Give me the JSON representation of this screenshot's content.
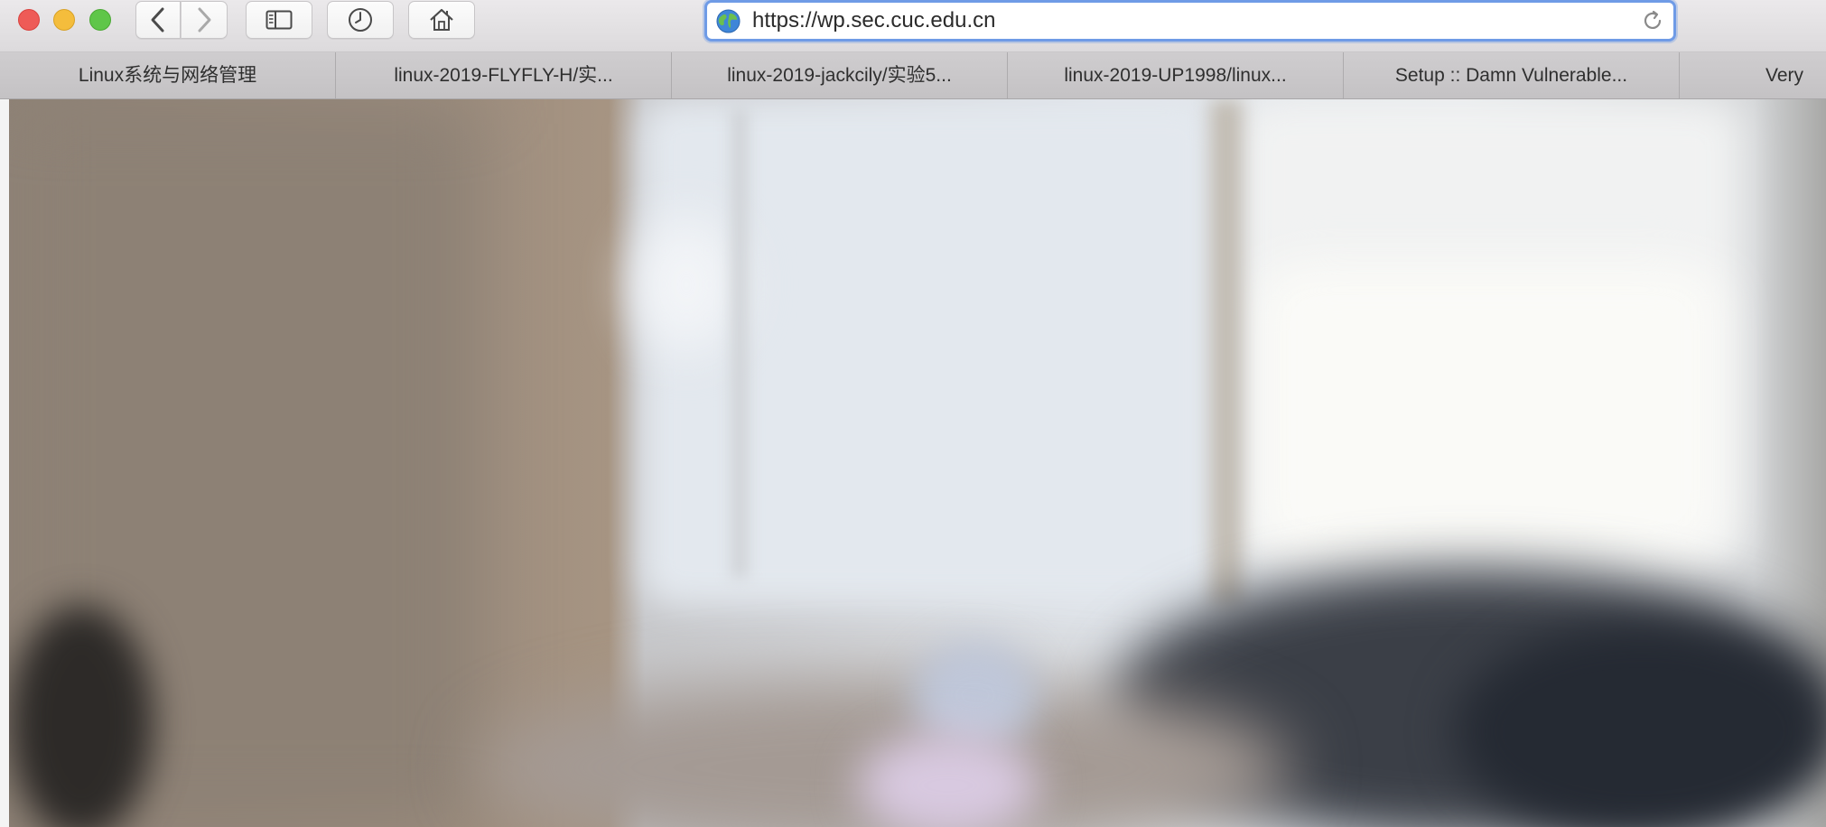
{
  "window": {
    "controls": {
      "close": "close-icon",
      "minimize": "minimize-icon",
      "zoom": "zoom-icon"
    }
  },
  "toolbar": {
    "back_icon": "chevron-left-icon",
    "forward_icon": "chevron-right-icon",
    "sidebar_icon": "sidebar-icon",
    "history_icon": "clock-icon",
    "home_icon": "home-icon"
  },
  "address_bar": {
    "url": "https://wp.sec.cuc.edu.cn",
    "site_icon": "globe-icon",
    "reload_icon": "reload-icon",
    "focus_color": "#6f9be6"
  },
  "bookmarks": [
    {
      "label": "Linux系统与网络管理"
    },
    {
      "label": "linux-2019-FLYFLY-H/实..."
    },
    {
      "label": "linux-2019-jackcily/实验5..."
    },
    {
      "label": "linux-2019-UP1998/linux..."
    },
    {
      "label": "Setup :: Damn Vulnerable..."
    },
    {
      "label": "Very"
    }
  ],
  "page": {
    "hero_image": "blurred-office-window-photo"
  },
  "colors": {
    "close": "#ee5b57",
    "minimize": "#f4bd3c",
    "zoom": "#5fc649"
  }
}
